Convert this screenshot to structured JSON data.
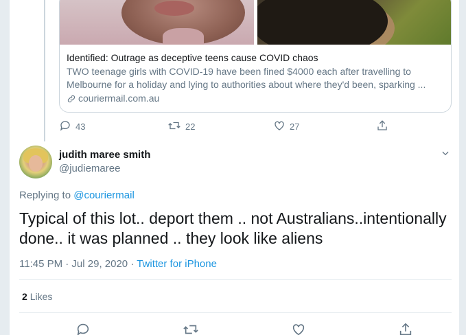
{
  "card": {
    "title": "Identified: Outrage as deceptive teens cause COVID chaos",
    "desc_line1": "TWO teenage girls with COVID-19 have been fined $4000 each after travelling to",
    "desc_line2": "Melbourne for a holiday and lying to authorities about where they'd been, sparking ...",
    "domain": "couriermail.com.au"
  },
  "parent_actions": {
    "replies": "43",
    "retweets": "22",
    "likes": "27"
  },
  "tweet": {
    "name": "judith maree smith",
    "handle": "@judiemaree",
    "replying_prefix": "Replying to",
    "replying_to": "@couriermail",
    "text_line1": "Typical of this lot.. deport them .. not Australians..intentionally",
    "text_line2": "done.. it was planned .. they look like aliens",
    "timestamp": "11:45 PM · Jul 29, 2020 · ",
    "source": "Twitter for iPhone",
    "likes_count": "2",
    "likes_label": "Likes"
  },
  "colors": {
    "link": "#1b95e0",
    "muted": "#657786",
    "border": "#e6ecf0"
  },
  "icons": [
    "reply-icon",
    "retweet-icon",
    "like-icon",
    "share-icon",
    "link-icon",
    "chevron-down-icon"
  ]
}
